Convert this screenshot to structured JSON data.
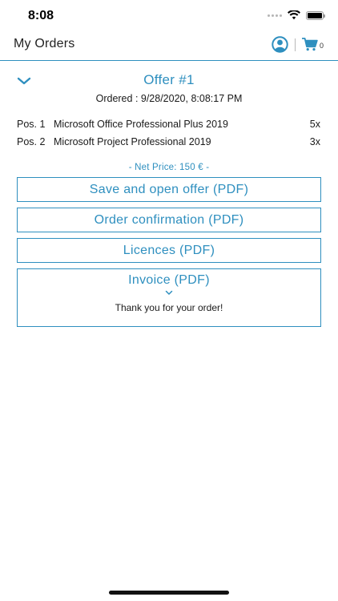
{
  "status_bar": {
    "time": "8:08"
  },
  "nav": {
    "title": "My Orders",
    "cart_count": "0"
  },
  "offer": {
    "title": "Offer #1",
    "ordered": "Ordered : 9/28/2020, 8:08:17 PM",
    "positions": [
      {
        "label": "Pos. 1",
        "name": "Microsoft Office Professional Plus 2019",
        "qty": "5x"
      },
      {
        "label": "Pos. 2",
        "name": "Microsoft Project Professional 2019",
        "qty": "3x"
      }
    ],
    "net_price": "- Net Price: 150 € -",
    "buttons": {
      "save_open": "Save and open offer (PDF)",
      "order_confirmation": "Order confirmation (PDF)",
      "licences": "Licences (PDF)",
      "invoice": "Invoice (PDF)"
    },
    "thanks": "Thank you for your order!"
  },
  "colors": {
    "accent": "#2e8fbf",
    "text": "#1a1a1a",
    "background": "#ffffff"
  },
  "icons": {
    "collapse": "chevron-down-icon",
    "account": "user-circle-icon",
    "cart": "shopping-cart-icon",
    "wifi": "wifi-icon",
    "battery": "battery-icon",
    "signal": "cellular-signal-icon"
  }
}
